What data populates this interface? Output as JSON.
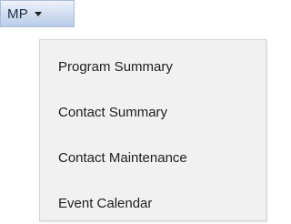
{
  "menu": {
    "button_label": "MP",
    "items": [
      {
        "label": "Program Summary"
      },
      {
        "label": "Contact Summary"
      },
      {
        "label": "Contact Maintenance"
      },
      {
        "label": "Event Calendar"
      }
    ]
  },
  "icons": {
    "dropdown_caret": "chevron-down-icon"
  },
  "colors": {
    "button_gradient_top": "#eef3fb",
    "button_gradient_bottom": "#b9cde9",
    "menu_background": "#f1f1f1"
  }
}
